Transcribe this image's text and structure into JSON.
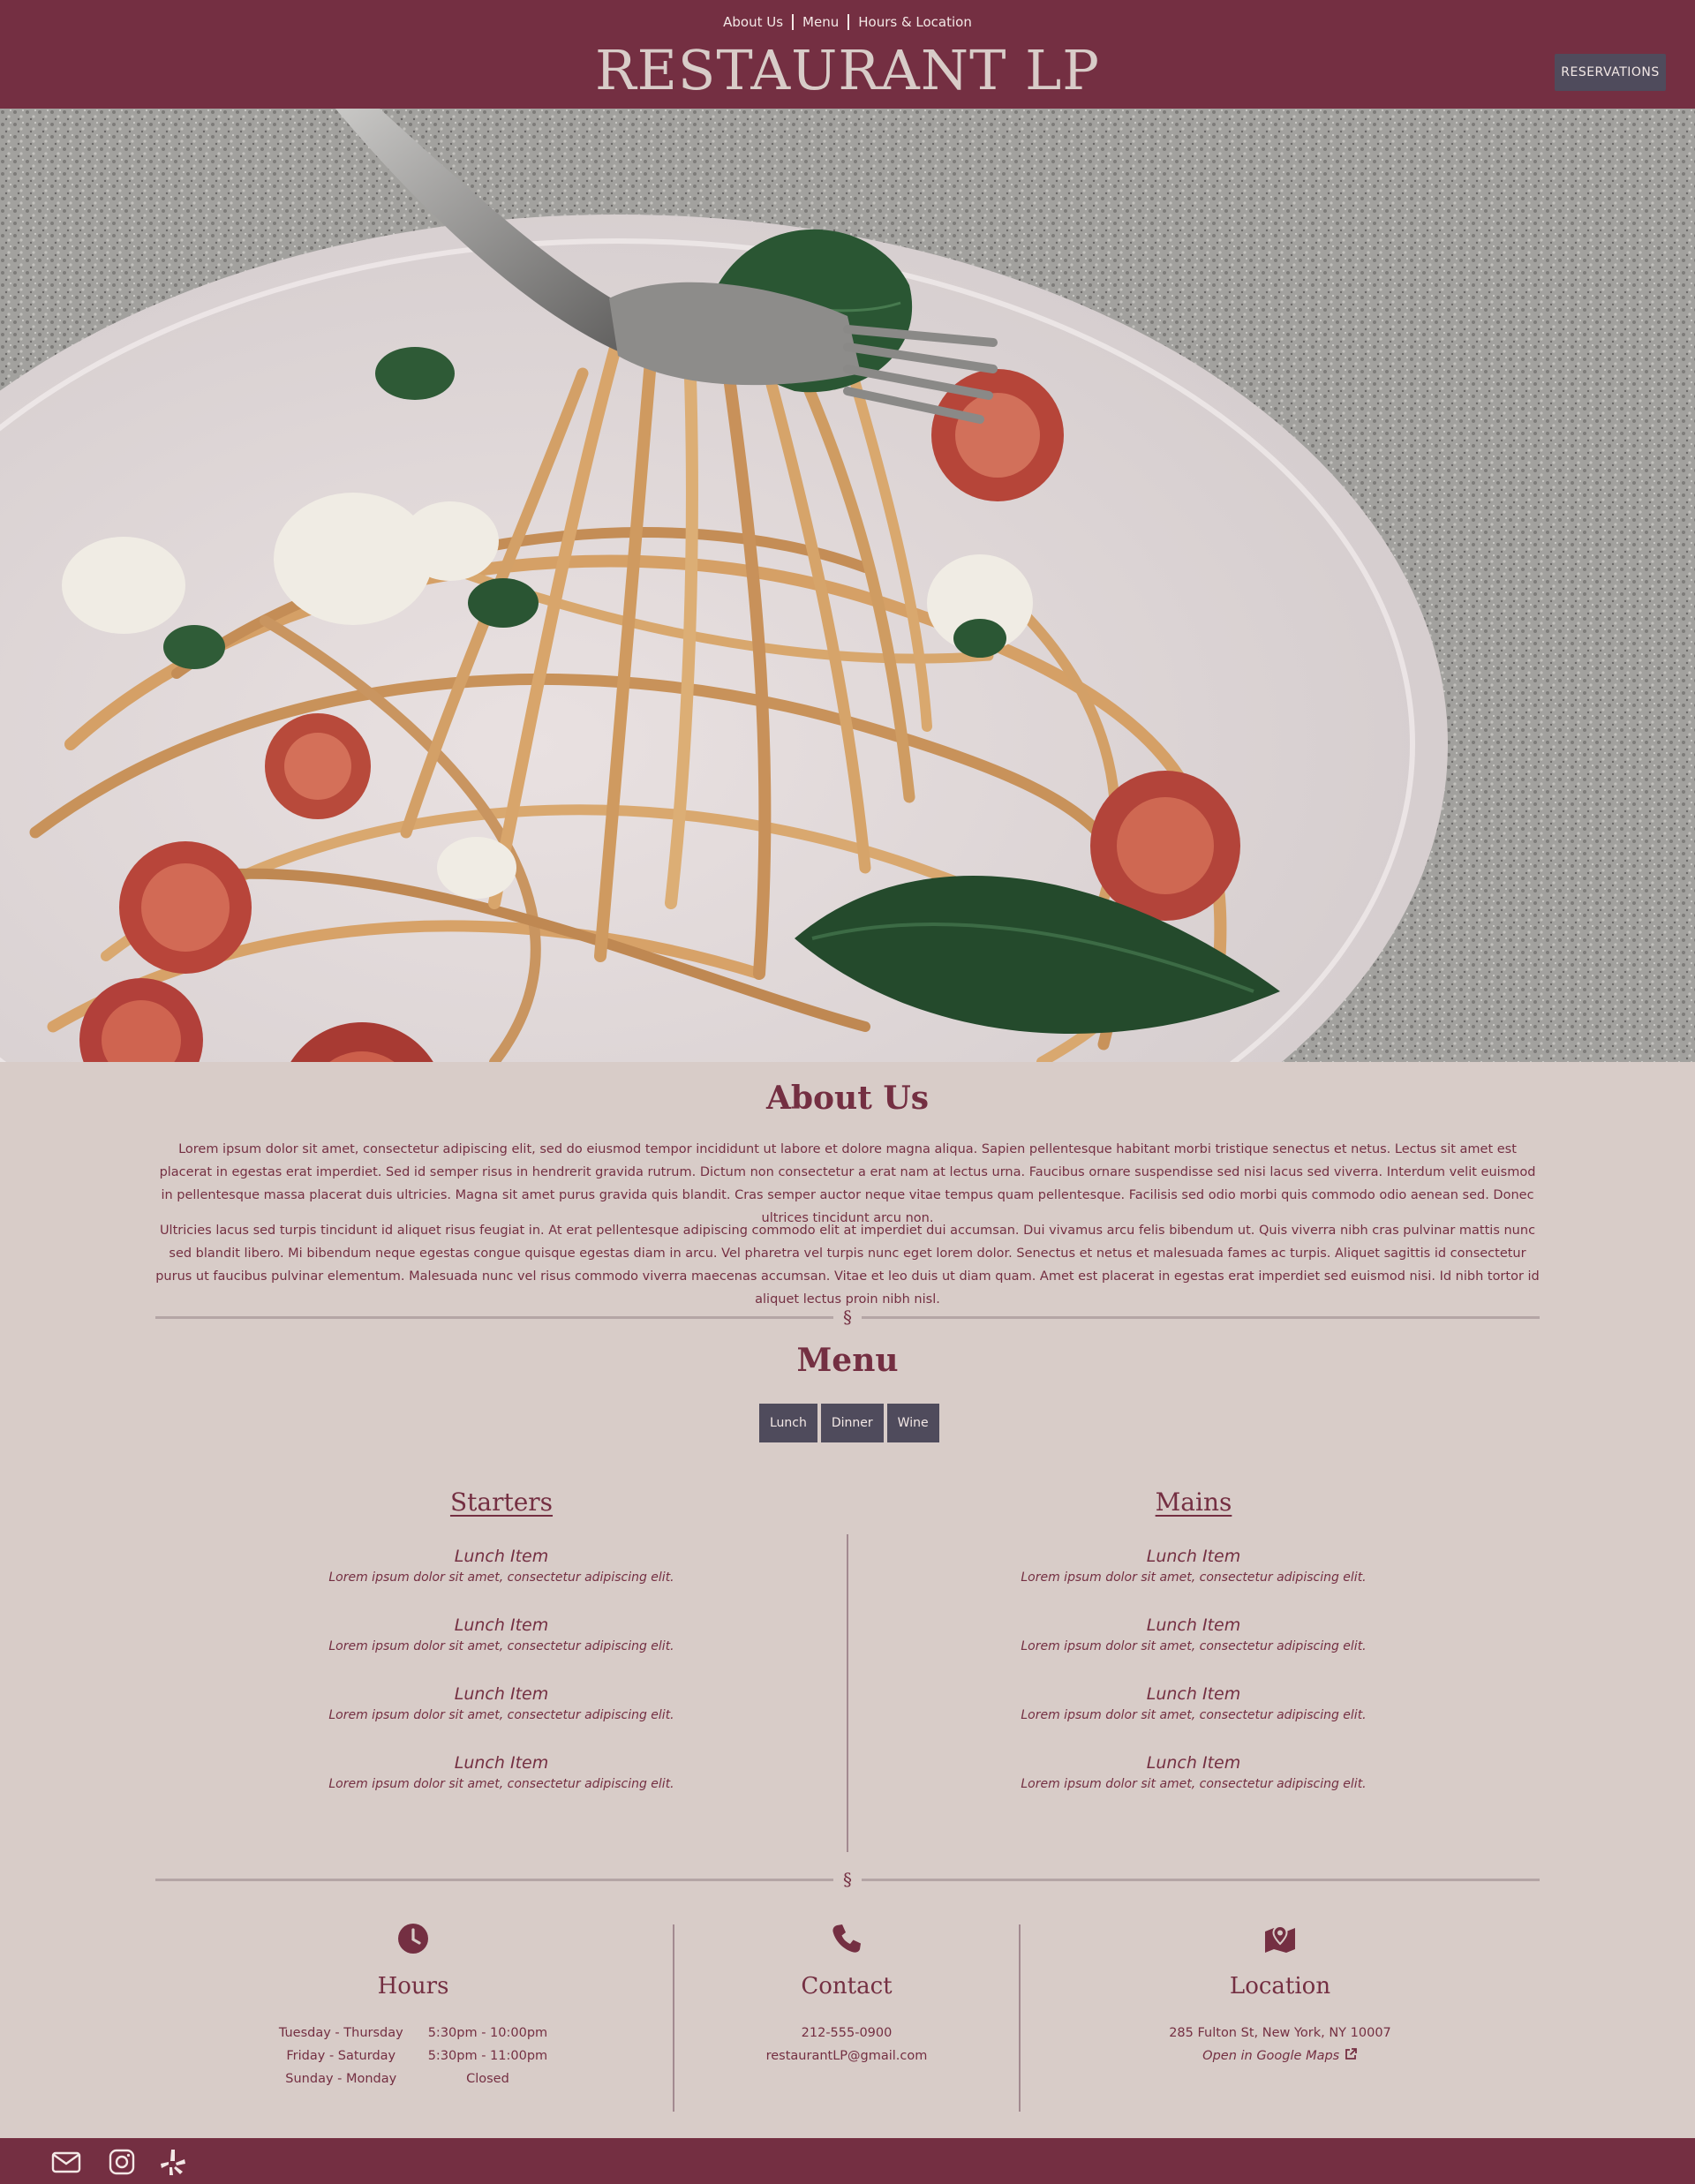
{
  "header": {
    "nav": [
      "About Us",
      "Menu",
      "Hours & Location"
    ],
    "logo": "RESTAURANT LP",
    "reservations_label": "RESERVATIONS"
  },
  "hero": {
    "image": "spaghetti-fork-photo"
  },
  "about": {
    "title": "About Us",
    "paragraphs": [
      "Lorem ipsum dolor sit amet, consectetur adipiscing elit, sed do eiusmod tempor incididunt ut labore et dolore magna aliqua. Sapien pellentesque habitant morbi tristique senectus et netus. Lectus sit amet est placerat in egestas erat imperdiet. Sed id semper risus in hendrerit gravida rutrum. Dictum non consectetur a erat nam at lectus urna. Faucibus ornare suspendisse sed nisi lacus sed viverra. Interdum velit euismod in pellentesque massa placerat duis ultricies. Magna sit amet purus gravida quis blandit. Cras semper auctor neque vitae tempus quam pellentesque. Facilisis sed odio morbi quis commodo odio aenean sed. Donec ultrices tincidunt arcu non.",
      "Ultricies lacus sed turpis tincidunt id aliquet risus feugiat in. At erat pellentesque adipiscing commodo elit at imperdiet dui accumsan. Dui vivamus arcu felis bibendum ut. Quis viverra nibh cras pulvinar mattis nunc sed blandit libero. Mi bibendum neque egestas congue quisque egestas diam in arcu. Vel pharetra vel turpis nunc eget lorem dolor. Senectus et netus et malesuada fames ac turpis. Aliquet sagittis id consectetur purus ut faucibus pulvinar elementum. Malesuada nunc vel risus commodo viverra maecenas accumsan. Vitae et leo duis ut diam quam. Amet est placerat in egestas erat imperdiet sed euismod nisi. Id nibh tortor id aliquet lectus proin nibh nisl."
    ]
  },
  "divider_mark": "§",
  "menu": {
    "title": "Menu",
    "tabs": [
      "Lunch",
      "Dinner",
      "Wine"
    ],
    "starters": {
      "title": "Starters",
      "items": [
        {
          "name": "Lunch Item",
          "desc": "Lorem ipsum dolor sit amet, consectetur adipiscing elit."
        },
        {
          "name": "Lunch Item",
          "desc": "Lorem ipsum dolor sit amet, consectetur adipiscing elit."
        },
        {
          "name": "Lunch Item",
          "desc": "Lorem ipsum dolor sit amet, consectetur adipiscing elit."
        },
        {
          "name": "Lunch Item",
          "desc": "Lorem ipsum dolor sit amet, consectetur adipiscing elit."
        }
      ]
    },
    "mains": {
      "title": "Mains",
      "items": [
        {
          "name": "Lunch Item",
          "desc": "Lorem ipsum dolor sit amet, consectetur adipiscing elit."
        },
        {
          "name": "Lunch Item",
          "desc": "Lorem ipsum dolor sit amet, consectetur adipiscing elit."
        },
        {
          "name": "Lunch Item",
          "desc": "Lorem ipsum dolor sit amet, consectetur adipiscing elit."
        },
        {
          "name": "Lunch Item",
          "desc": "Lorem ipsum dolor sit amet, consectetur adipiscing elit."
        }
      ]
    }
  },
  "hours": {
    "title": "Hours",
    "rows": [
      {
        "days": "Tuesday - Thursday",
        "time": "5:30pm - 10:00pm"
      },
      {
        "days": "Friday - Saturday",
        "time": "5:30pm - 11:00pm"
      },
      {
        "days": "Sunday - Monday",
        "time": "Closed"
      }
    ]
  },
  "contact": {
    "title": "Contact",
    "phone": "212-555-0900",
    "email": "restaurantLP@gmail.com"
  },
  "location": {
    "title": "Location",
    "address": "285 Fulton St, New York, NY 10007",
    "maps_link": "Open in Google Maps"
  },
  "footer": {
    "icons": [
      "mail-icon",
      "instagram-icon",
      "yelp-icon"
    ]
  },
  "colors": {
    "brand": "#742f42",
    "background": "#d8ccc8",
    "button": "#4f4b5c",
    "logo_text": "#d8ccc8"
  }
}
